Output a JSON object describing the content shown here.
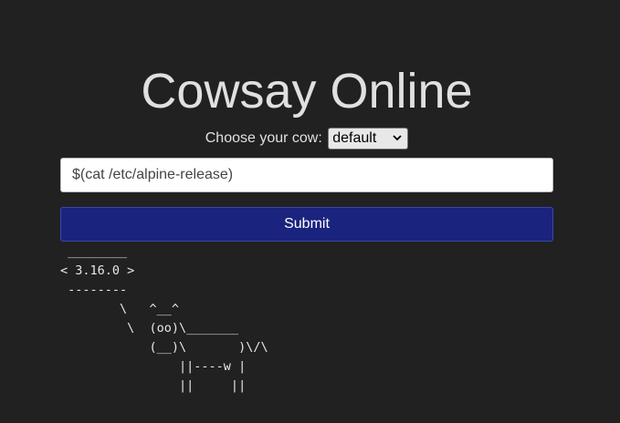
{
  "page": {
    "title": "Cowsay Online"
  },
  "form": {
    "cow_label": "Choose your cow:",
    "cow_selected": "default",
    "message_value": "$(cat /etc/alpine-release)",
    "submit_label": "Submit"
  },
  "output": {
    "cowsay_text": " ________\n< 3.16.0 >\n --------\n        \\   ^__^\n         \\  (oo)\\_______\n            (__)\\       )\\/\\\n                ||----w |\n                ||     ||"
  }
}
